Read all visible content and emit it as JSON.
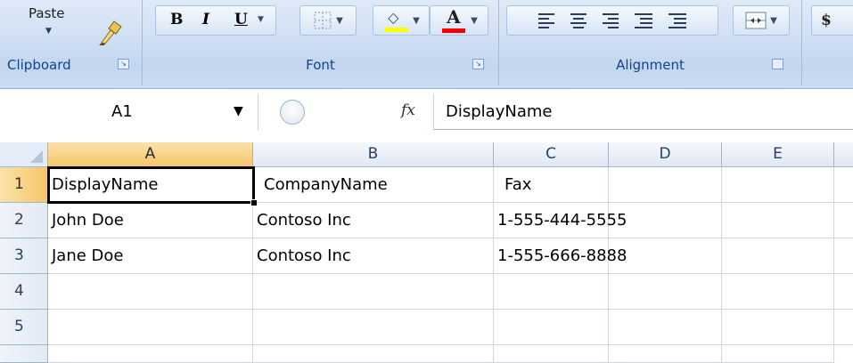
{
  "ribbon": {
    "clipboard": {
      "paste_label": "Paste",
      "group_label": "Clipboard"
    },
    "font": {
      "group_label": "Font",
      "bold_label": "B",
      "italic_label": "I",
      "underline_label": "U",
      "font_color_label": "A",
      "fill_color_swatch": "#ffff00",
      "font_color_swatch": "#ff0000"
    },
    "alignment": {
      "group_label": "Alignment"
    },
    "number": {
      "currency_label": "$"
    }
  },
  "formula_bar": {
    "name_box": "A1",
    "fx_label": "fx",
    "value": "DisplayName"
  },
  "sheet": {
    "columns": [
      "A",
      "B",
      "C",
      "D",
      "E"
    ],
    "rows": [
      {
        "n": "1",
        "a": "DisplayName",
        "b": "CompanyName",
        "c": "Fax"
      },
      {
        "n": "2",
        "a": "John Doe",
        "b": "Contoso Inc",
        "c": "1-555-444-5555"
      },
      {
        "n": "3",
        "a": "Jane Doe",
        "b": "Contoso Inc",
        "c": "1-555-666-8888"
      },
      {
        "n": "4",
        "a": "",
        "b": "",
        "c": ""
      },
      {
        "n": "5",
        "a": "",
        "b": "",
        "c": ""
      }
    ],
    "active_cell": "A1",
    "header_highlight": "#f6c56b",
    "gridline_color": "#d0d7e5"
  }
}
